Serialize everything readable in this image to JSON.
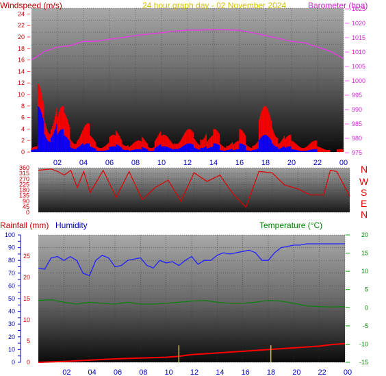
{
  "header": {
    "wind_title": "Windspeed (m/s)",
    "date_title": "24 hour graph day - 02 November 2024",
    "baro_title": "Barometer (hpa)"
  },
  "lower_header": {
    "rain_title": "Rainfall (mm)",
    "humidity_title": "Humidity",
    "temp_title": "Temperature (°C)"
  },
  "direction_labels": [
    "N",
    "W",
    "S",
    "E",
    "N"
  ],
  "x_ticks": [
    "02",
    "04",
    "06",
    "08",
    "10",
    "12",
    "14",
    "16",
    "18",
    "20",
    "22",
    "00"
  ],
  "colors": {
    "wind": "#ff0000",
    "wind_avg": "#0000ff",
    "barometer": "#e040e0",
    "date_title": "#d4c000",
    "direction": "#e00000",
    "rain": "#ff0000",
    "rain_rate": "#c8c820",
    "humidity": "#2020ff",
    "temperature": "#108010",
    "temp_axis": "#008000",
    "hum_axis": "#0000c0",
    "rain_axis": "#e00000"
  },
  "chart_data": [
    {
      "type": "line",
      "name": "wind-barometer",
      "x_ticks": [
        "02",
        "04",
        "06",
        "08",
        "10",
        "12",
        "14",
        "16",
        "18",
        "20",
        "22",
        "00"
      ],
      "y_left_ticks": [
        "0",
        "2",
        "4",
        "6",
        "8",
        "10",
        "12",
        "14",
        "16",
        "18",
        "20",
        "22",
        "24"
      ],
      "y_left_range": [
        0,
        25
      ],
      "y_right_ticks": [
        "975",
        "980",
        "985",
        "990",
        "995",
        "1000",
        "1005",
        "1010",
        "1015",
        "1020",
        "1025"
      ],
      "y_right_range": [
        975,
        1025
      ],
      "ylabel_left": "Windspeed (m/s)",
      "ylabel_right": "Barometer (hpa)",
      "barometer": {
        "x": [
          0,
          1,
          2,
          3,
          4,
          5,
          6,
          7,
          8,
          9,
          10,
          11,
          12,
          13,
          14,
          15,
          16,
          17,
          18,
          19,
          20,
          21,
          22,
          23,
          24
        ],
        "values": [
          1007,
          1010,
          1011.5,
          1012,
          1013.5,
          1013.5,
          1014.2,
          1014.8,
          1015.5,
          1016,
          1016.5,
          1017,
          1017.4,
          1017.4,
          1017.5,
          1017.5,
          1017.3,
          1016.5,
          1015.5,
          1014.5,
          1013.5,
          1013,
          1011.5,
          1010,
          1007.5
        ]
      },
      "wind_gust": {
        "x": [
          0,
          0.5,
          1,
          1.5,
          2,
          2.5,
          3,
          3.5,
          4,
          4.5,
          5,
          5.5,
          6,
          6.5,
          7,
          7.5,
          8,
          8.5,
          9,
          9.5,
          10,
          10.5,
          11,
          11.5,
          12,
          12.5,
          13,
          13.5,
          14,
          14.5,
          15,
          15.5,
          16,
          16.5,
          17,
          17.5,
          18,
          18.5,
          19,
          19.5,
          20,
          20.5,
          21,
          21.5,
          22,
          22.5,
          23,
          23.5,
          24
        ],
        "values": [
          1,
          12,
          9,
          11,
          8,
          7,
          4,
          5,
          5,
          3,
          2,
          2,
          3,
          4,
          3,
          2,
          2,
          3,
          2,
          4,
          3,
          3,
          4,
          4,
          4,
          3,
          6,
          3,
          4,
          2,
          3,
          2,
          4,
          2,
          3,
          8,
          8,
          7,
          4,
          3,
          2,
          2,
          2,
          2,
          1,
          1,
          0,
          0.5,
          0
        ]
      },
      "wind_avg": {
        "x": [
          0,
          0.5,
          1,
          1.5,
          2,
          2.5,
          3,
          3.5,
          4,
          4.5,
          5,
          5.5,
          6,
          6.5,
          7,
          7.5,
          8,
          8.5,
          9,
          9.5,
          10,
          10.5,
          11,
          11.5,
          12,
          12.5,
          13,
          13.5,
          14,
          14.5,
          15,
          15.5,
          16,
          16.5,
          17,
          17.5,
          18,
          18.5,
          19,
          19.5,
          20,
          20.5,
          21,
          21.5,
          22,
          22.5,
          23,
          23.5,
          24
        ],
        "values": [
          0.5,
          8,
          5,
          7,
          4,
          3,
          1.5,
          2,
          1.5,
          1,
          0.5,
          0.5,
          1,
          1.5,
          1,
          0.5,
          0.5,
          1,
          0.5,
          1.5,
          1,
          1,
          1.5,
          1.5,
          1.5,
          1,
          2,
          1,
          1.5,
          0.5,
          1,
          0.5,
          1.5,
          0.5,
          1,
          3,
          3,
          2.5,
          1.5,
          1,
          0.5,
          0.5,
          0.5,
          0.5,
          0,
          0,
          0,
          0,
          0
        ]
      }
    },
    {
      "type": "line",
      "name": "wind-direction",
      "y_ticks": [
        "0",
        "45",
        "90",
        "135",
        "180",
        "225",
        "270",
        "315",
        "360"
      ],
      "y_range": [
        0,
        360
      ],
      "x": [
        0,
        1,
        1.5,
        2,
        2.5,
        3,
        3.5,
        4,
        5,
        6,
        7,
        8,
        9,
        10,
        11,
        12,
        13,
        14,
        15,
        16,
        17,
        18,
        19,
        20,
        21,
        22,
        22.5,
        23,
        24
      ],
      "values": [
        340,
        350,
        330,
        300,
        340,
        200,
        330,
        160,
        340,
        120,
        330,
        100,
        200,
        260,
        90,
        320,
        250,
        300,
        150,
        40,
        330,
        320,
        220,
        190,
        140,
        140,
        340,
        330,
        130
      ]
    },
    {
      "type": "line",
      "name": "rain-humidity-temperature",
      "y_left_rain_ticks": [
        "0",
        "5",
        "10",
        "15",
        "20",
        "25"
      ],
      "y_left_rain_range": [
        0,
        30
      ],
      "y_left_hum_ticks": [
        "0",
        "10",
        "20",
        "30",
        "40",
        "50",
        "60",
        "70",
        "80",
        "90",
        "100"
      ],
      "y_left_hum_range": [
        0,
        100
      ],
      "y_right_temp_ticks": [
        "-15",
        "-10",
        "-5",
        "0",
        "5",
        "10",
        "15",
        "20"
      ],
      "y_right_temp_range": [
        -15,
        20
      ],
      "humidity": {
        "x": [
          0,
          0.5,
          1,
          1.5,
          2,
          2.5,
          3,
          3.5,
          4,
          4.5,
          5,
          5.5,
          6,
          6.5,
          7,
          7.5,
          8,
          8.5,
          9,
          9.5,
          10,
          10.5,
          11,
          11.5,
          12,
          12.5,
          13,
          13.5,
          14,
          14.5,
          15,
          15.5,
          16,
          16.5,
          17,
          17.5,
          18,
          18.5,
          19,
          19.5,
          20,
          20.5,
          21,
          21.5,
          22,
          22.5,
          23,
          23.5,
          24
        ],
        "values": [
          74,
          73,
          82,
          83,
          80,
          83,
          80,
          70,
          68,
          80,
          84,
          82,
          75,
          76,
          80,
          81,
          82,
          76,
          74,
          80,
          78,
          79,
          76,
          80,
          83,
          77,
          80,
          80,
          84,
          86,
          85,
          86,
          87,
          88,
          86,
          80,
          80,
          86,
          90,
          91,
          92,
          92,
          93,
          93,
          93,
          93,
          93,
          93,
          93
        ]
      },
      "temperature": {
        "x": [
          0,
          1,
          2,
          3,
          4,
          5,
          6,
          7,
          8,
          9,
          10,
          11,
          12,
          13,
          14,
          15,
          16,
          17,
          18,
          19,
          20,
          21,
          22,
          23,
          24
        ],
        "values": [
          2,
          2.2,
          1.5,
          1,
          1.5,
          1.2,
          1,
          1.5,
          1,
          1,
          1.2,
          1.5,
          1.8,
          2,
          1.5,
          1.2,
          1.2,
          1.5,
          2,
          1.8,
          1.2,
          0.5,
          0.3,
          0.2,
          0.3
        ]
      },
      "rain": {
        "x": [
          0,
          2,
          4,
          6,
          8,
          10,
          11,
          12,
          14,
          16,
          18,
          20,
          22,
          23,
          24
        ],
        "values": [
          0,
          0.2,
          0.5,
          0.8,
          1,
          1.2,
          1.4,
          1.8,
          2.2,
          2.6,
          3,
          3.4,
          3.8,
          4.2,
          4.4
        ]
      },
      "rain_rate": {
        "x": [
          11,
          18.2
        ],
        "values": [
          4,
          4
        ]
      }
    }
  ]
}
